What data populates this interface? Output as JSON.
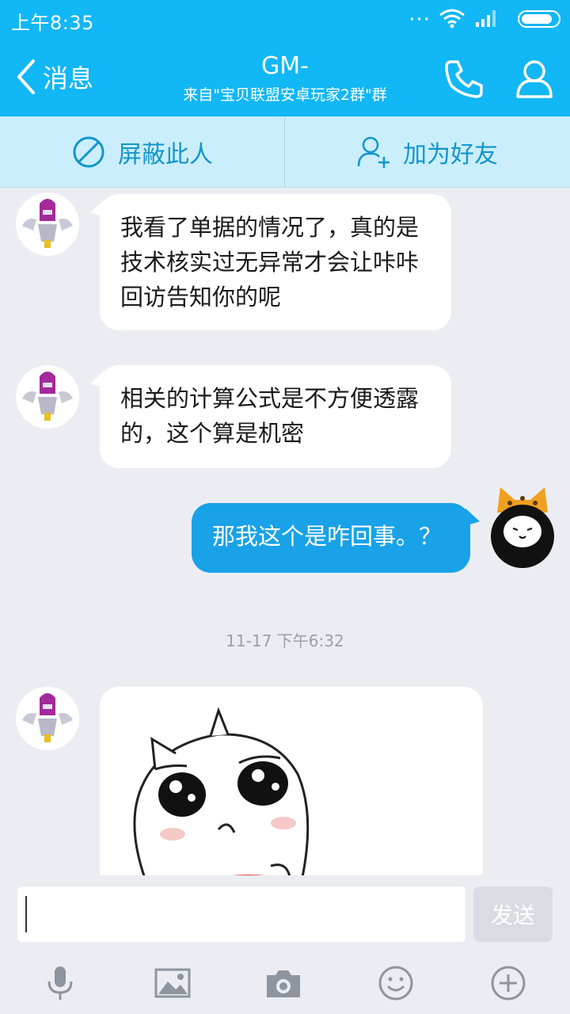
{
  "status_bar": {
    "time": "上午8:35",
    "dots": "···"
  },
  "header": {
    "back_label": "消息",
    "title": "GM-",
    "subtitle": "来自\"宝贝联盟安卓玩家2群\"群",
    "icons": [
      "chevron-left-icon",
      "phone-icon",
      "user-icon"
    ]
  },
  "actions": {
    "block_label": "屏蔽此人",
    "add_friend_label": "加为好友"
  },
  "messages": [
    {
      "direction": "in",
      "text": "我看了单据的情况了，真的是技术核实过无异常才会让咔咔回访告知你的呢"
    },
    {
      "direction": "in",
      "text": "相关的计算公式是不方便透露的，这个算是机密"
    },
    {
      "direction": "out",
      "text": "那我这个是咋回事。？"
    },
    {
      "direction": "in",
      "type": "image",
      "text": ""
    }
  ],
  "timestamp": "11-17 下午6:32",
  "input": {
    "value": "",
    "placeholder": "",
    "send_label": "发送"
  },
  "toolbar": {
    "icons": [
      "microphone-icon",
      "image-icon",
      "camera-icon",
      "emoji-icon",
      "plus-icon"
    ]
  },
  "colors": {
    "brand": "#12b7f5",
    "outgoing_bubble": "#19a2e8",
    "action_bar_bg": "#cbeefc",
    "action_text": "#1196cc",
    "chat_bg": "#ebedf2"
  }
}
